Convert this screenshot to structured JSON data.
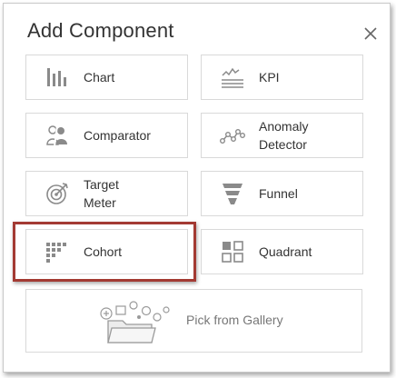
{
  "dialog": {
    "title": "Add Component",
    "close_icon": "close-icon"
  },
  "tiles": {
    "chart": {
      "label": "Chart",
      "icon": "bar-chart-icon"
    },
    "kpi": {
      "label": "KPI",
      "icon": "kpi-icon"
    },
    "comparator": {
      "label": "Comparator",
      "icon": "comparator-icon"
    },
    "anomaly": {
      "label": "Anomaly\nDetector",
      "icon": "anomaly-detector-icon"
    },
    "target_meter": {
      "label": "Target\nMeter",
      "icon": "target-meter-icon"
    },
    "funnel": {
      "label": "Funnel",
      "icon": "funnel-icon"
    },
    "cohort": {
      "label": "Cohort",
      "icon": "cohort-grid-icon",
      "highlighted": true
    },
    "quadrant": {
      "label": "Quadrant",
      "icon": "quadrant-icon"
    }
  },
  "gallery": {
    "label": "Pick from Gallery",
    "icon": "gallery-folder-icon"
  },
  "colors": {
    "highlight_border": "#a33a33",
    "icon_gray": "#8a8a8a",
    "text": "#333333"
  }
}
